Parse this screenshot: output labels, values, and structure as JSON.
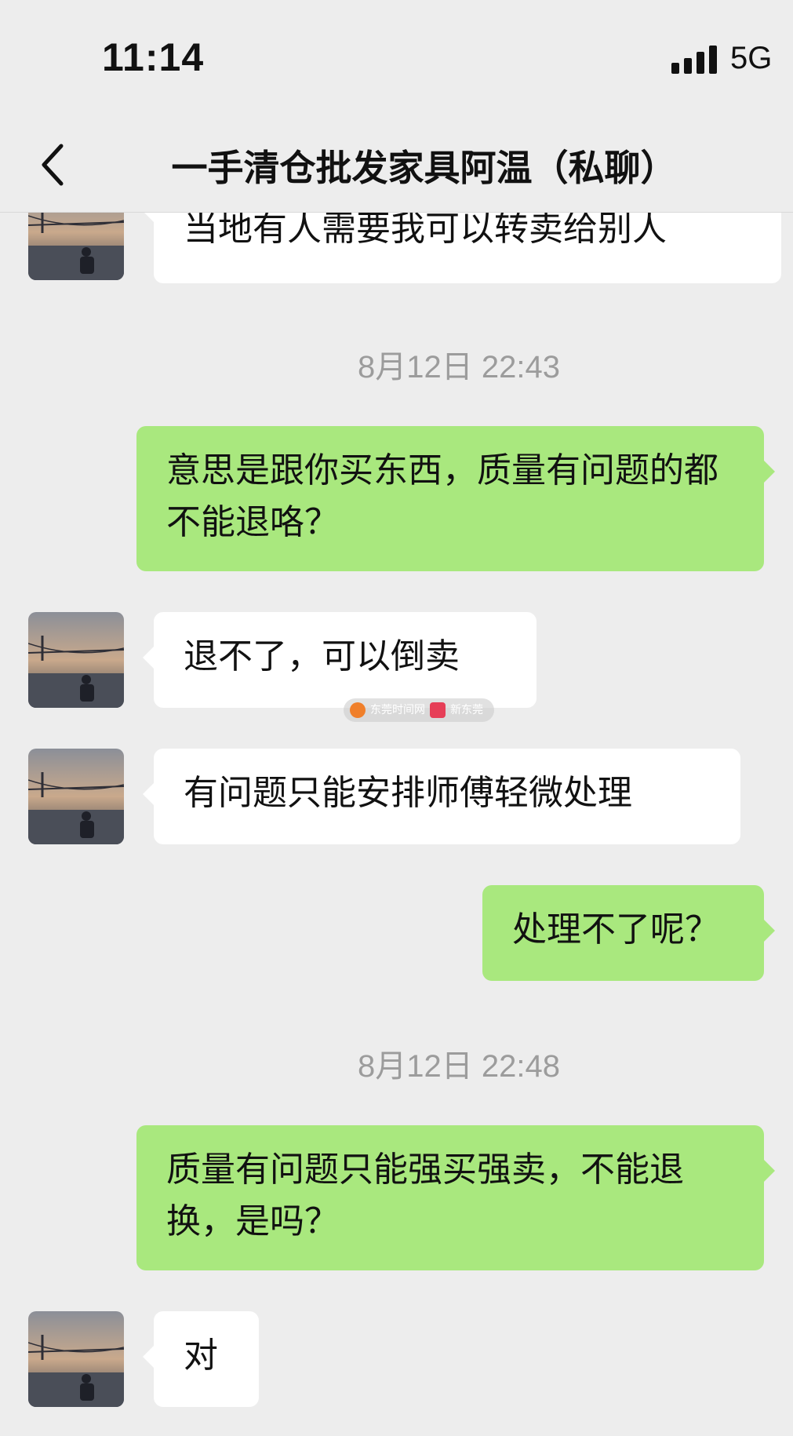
{
  "status_bar": {
    "time": "11:14",
    "network": "5G"
  },
  "nav": {
    "title": "一手清仓批发家具阿温（私聊）"
  },
  "messages": [
    {
      "side": "left",
      "text": "当地有人需要我可以转卖给别人"
    },
    {
      "type": "time",
      "text": "8月12日 22:43"
    },
    {
      "side": "right",
      "text": "意思是跟你买东西，质量有问题的都不能退咯？"
    },
    {
      "side": "left",
      "text": "退不了，可以倒卖"
    },
    {
      "side": "left",
      "text": "有问题只能安排师傅轻微处理"
    },
    {
      "side": "right",
      "text": "处理不了呢？"
    },
    {
      "type": "time",
      "text": "8月12日 22:48"
    },
    {
      "side": "right",
      "text": "质量有问题只能强买强卖，不能退换，是吗？"
    },
    {
      "side": "left",
      "text": "对"
    }
  ],
  "watermark": {
    "left_text": "东莞时间网",
    "right_text": "新东莞"
  },
  "colors": {
    "background": "#ededed",
    "bubble_self": "#a9e87e",
    "bubble_other": "#ffffff",
    "timestamp": "#9c9c9c"
  },
  "icons": [
    "back-chevron-icon",
    "signal-bars-icon",
    "avatar-image"
  ]
}
